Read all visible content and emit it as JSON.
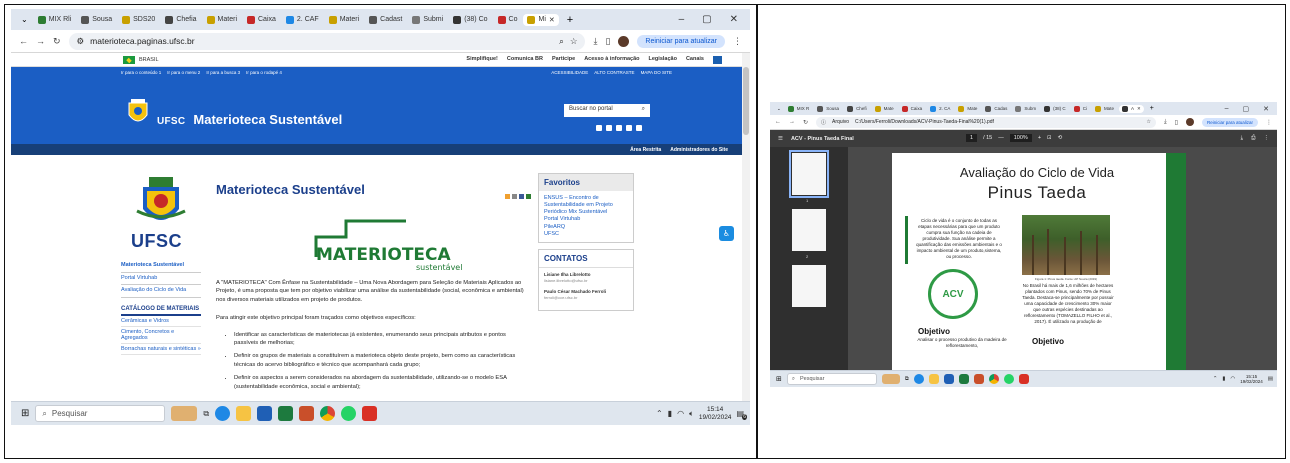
{
  "left": {
    "tabs": [
      {
        "label": "MIX Rli",
        "color": "#2e7d32"
      },
      {
        "label": "Sousa",
        "color": "#555555"
      },
      {
        "label": "SDS20",
        "color": "#c8a000"
      },
      {
        "label": "Chefia",
        "color": "#444444"
      },
      {
        "label": "Materi",
        "color": "#c8a000"
      },
      {
        "label": "Caixa",
        "color": "#c62828"
      },
      {
        "label": "2. CAF",
        "color": "#1e88e5"
      },
      {
        "label": "Materi",
        "color": "#c8a000"
      },
      {
        "label": "Cadast",
        "color": "#555555"
      },
      {
        "label": "Submi",
        "color": "#777777"
      },
      {
        "label": "(38) Co",
        "color": "#333333"
      },
      {
        "label": "Co",
        "color": "#c62828"
      },
      {
        "label": "Mi",
        "color": "#c8a000",
        "active": true
      }
    ],
    "new_tab": "+",
    "url": "materioteca.paginas.ufsc.br",
    "update_pill": "Reiniciar para atualizar",
    "gov": {
      "country": "BRASIL",
      "links": [
        "Simplifique!",
        "Comunica BR",
        "Participe",
        "Acesso à informação",
        "Legislação",
        "Canais"
      ]
    },
    "access_links": [
      "Ir para o conteúdo 1",
      "Ir para o menu 2",
      "Ir para a busca 3",
      "Ir para o rodapé 4"
    ],
    "access_right": [
      "ACESSIBILIDADE",
      "ALTO CONTRASTE",
      "MAPA DO SITE"
    ],
    "brand": {
      "ufsc": "UFSC",
      "title": "Materioteca Sustentável"
    },
    "search_placeholder": "Buscar no portal",
    "dark_links": [
      "Área Restrita",
      "Administradores do Site"
    ],
    "sidebar_left": {
      "logo_text": "UFSC",
      "nav": [
        {
          "label": "Materioteca Sustentável",
          "bold": true
        },
        {
          "label": "Portal Virtuhab",
          "bold": false
        },
        {
          "label": "Avaliação do Ciclo de Vida",
          "bold": false
        }
      ],
      "catalog_title": "CATÁLOGO DE MATERIAIS",
      "catalog": [
        "Cerâmicas e Vidros",
        "Cimento, Concretos e Agregados",
        "Borrachas naturais e sintéticas »"
      ]
    },
    "main": {
      "title": "Materioteca Sustentável",
      "logo_word": "MATERIOTECA",
      "logo_sub": "sustentável",
      "p1": "A \"MATERIOTECA\" Com Ênfase na Sustentabilidade – Uma Nova Abordagem para Seleção de Materiais Aplicados ao Projeto, é uma proposta que tem por objetivo viabilizar uma análise da sustentabilidade (social, econômica e ambiental) nos diversos materiais utilizados em projeto de produtos.",
      "p2": "Para atingir este objetivo principal foram traçados como objetivos específicos:",
      "bullets": [
        "Identificar as características de materiotecas já existentes, enumerando seus principais atributos e pontos passíveis de melhorias;",
        "Definir os grupos de materiais a constituírem a materioteca objeto deste projeto, bem como as características técnicas do acervo bibliográfico e técnico que acompanhará cada grupo;",
        "Definir os aspectos a serem considerados na abordagem da sustentabilidade, utilizando-se o modelo ESA (sustentabilidade econômica, social e ambiental);"
      ]
    },
    "favorites": {
      "title": "Favoritos",
      "links": [
        "ENSUS – Encontro de Sustentabilidade em Projeto",
        "Periódico Mix Sustentável",
        "Portal Virtuhab",
        "PileARQ",
        "UFSC"
      ]
    },
    "contacts": {
      "title": "CONTATOS",
      "people": [
        {
          "name": "Lisiane Ilha Librelotto",
          "email": "lisiane.librelotto@ufsc.br"
        },
        {
          "name": "Paulo César Machado Ferroli",
          "email": "ferroli@cce.ufsc.br"
        }
      ]
    },
    "taskbar": {
      "search": "Pesquisar",
      "time": "15:14",
      "date": "19/02/2024",
      "notif": "6"
    }
  },
  "right": {
    "tabs": [
      {
        "label": "MIX R",
        "color": "#2e7d32"
      },
      {
        "label": "Sousa",
        "color": "#555555"
      },
      {
        "label": "Chefi",
        "color": "#444444"
      },
      {
        "label": "Mate",
        "color": "#c8a000"
      },
      {
        "label": "Caixa",
        "color": "#c62828"
      },
      {
        "label": "2. CA",
        "color": "#1e88e5"
      },
      {
        "label": "Mate",
        "color": "#c8a000"
      },
      {
        "label": "Cadas",
        "color": "#555555"
      },
      {
        "label": "Subm",
        "color": "#777777"
      },
      {
        "label": "(38) C",
        "color": "#333333"
      },
      {
        "label": "Ci",
        "color": "#c62828"
      },
      {
        "label": "Mate",
        "color": "#c8a000"
      },
      {
        "label": "A",
        "color": "#333333",
        "active": true
      }
    ],
    "url_label": "Arquivo",
    "url": "C:/Users/Ferroli/Downloads/ACV-Pinus-Taeda-Final%20(1).pdf",
    "update_pill": "Reiniciar para atualizar",
    "pdf": {
      "name": "ACV - Pinus Taeda Final",
      "page": "1",
      "pages": "/ 15",
      "zoom": "100%",
      "thumb_numbers": [
        "1",
        "2"
      ]
    },
    "page": {
      "title": "Avaliação do Ciclo de Vida",
      "subtitle": "Pinus Taeda",
      "text1": "Ciclo de vida é o conjunto de todas as etapas necessárias para que um produto cumpra sua função na cadeia de produtividade. Sua análise permite a quantificação das emissões ambientais e o impacto ambiental de um produto,sistema, ou processo.",
      "caption": "Figura 1: Pinus taeda. Fonte: AP Souza (2019)",
      "text2": "No Brasil há mais de 1,6 milhões de hectares plantados com Pinus, sendo 70% de Pinus Taeda. Destaca-se principalmente por possuir uma capacidade de crescimento 30% maior que outras espécies destinadas ao reflorestamento (TOMAZELLO FILHO et al., 2017). É utilizado na produção de",
      "acv": "ACV",
      "objective_left": "Objetivo",
      "text3": "Analisar o processo produtivo da madeira de reflorestamento,",
      "objective_right": "Objetivo"
    },
    "taskbar": {
      "search": "Pesquisar",
      "time": "15:15",
      "date": "19/02/2024"
    }
  },
  "colors": {
    "ufsc_blue": "#1b5ec4",
    "ufsc_dark": "#173f78",
    "green": "#1f7a34"
  }
}
